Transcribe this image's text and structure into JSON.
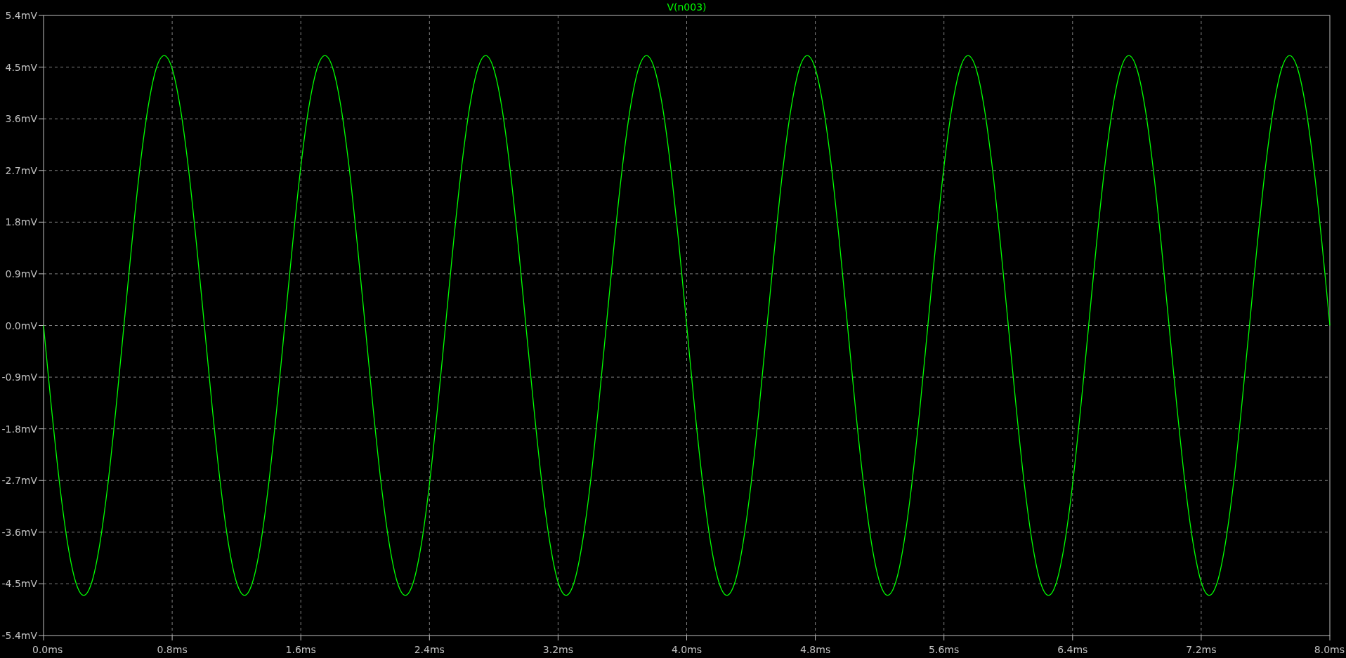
{
  "plot": {
    "chart_data": {
      "type": "line",
      "x": [
        0,
        0.05,
        0.1,
        0.15,
        0.2,
        0.25,
        0.3,
        0.35,
        0.4,
        0.45,
        0.5,
        0.55,
        0.6,
        0.65,
        0.7,
        0.75,
        0.8,
        0.85,
        0.9,
        0.95,
        1,
        1.05,
        1.1,
        1.15,
        1.2,
        1.25,
        1.3,
        1.35,
        1.4,
        1.45,
        1.5,
        1.55,
        1.6,
        1.65,
        1.7,
        1.75,
        1.8,
        1.85,
        1.9,
        1.95,
        2,
        2.05,
        2.1,
        2.15,
        2.2,
        2.25,
        2.3,
        2.35,
        2.4,
        2.45,
        2.5,
        2.55,
        2.6,
        2.65,
        2.7,
        2.75,
        2.8,
        2.85,
        2.9,
        2.95,
        3,
        3.05,
        3.1,
        3.15,
        3.2,
        3.25,
        3.3,
        3.35,
        3.4,
        3.45,
        3.5,
        3.55,
        3.6,
        3.65,
        3.7,
        3.75,
        3.8,
        3.85,
        3.9,
        3.95,
        4,
        4.05,
        4.1,
        4.15,
        4.2,
        4.25,
        4.3,
        4.35,
        4.4,
        4.45,
        4.5,
        4.55,
        4.6,
        4.65,
        4.7,
        4.75,
        4.8,
        4.85,
        4.9,
        4.95,
        5,
        5.05,
        5.1,
        5.15,
        5.2,
        5.25,
        5.3,
        5.35,
        5.4,
        5.45,
        5.5,
        5.55,
        5.6,
        5.65,
        5.7,
        5.75,
        5.8,
        5.85,
        5.9,
        5.95,
        6,
        6.05,
        6.1,
        6.15,
        6.2,
        6.25,
        6.3,
        6.35,
        6.4,
        6.45,
        6.5,
        6.55,
        6.6,
        6.65,
        6.7,
        6.75,
        6.8,
        6.85,
        6.9,
        6.95,
        7,
        7.05,
        7.1,
        7.15,
        7.2,
        7.25,
        7.3,
        7.35,
        7.4,
        7.45,
        7.5,
        7.55,
        7.6,
        7.65,
        7.7,
        7.75,
        7.8,
        7.85,
        7.9,
        7.95,
        8
      ],
      "series": [
        {
          "name": "V(n003)",
          "color": "#00ff00",
          "values": [
            0,
            -1.452,
            -2.764,
            -3.802,
            -4.47,
            -4.7,
            -4.47,
            -3.802,
            -2.764,
            -1.452,
            0,
            1.452,
            2.764,
            3.802,
            4.47,
            4.7,
            4.47,
            3.802,
            2.764,
            1.452,
            0,
            -1.452,
            -2.764,
            -3.802,
            -4.47,
            -4.7,
            -4.47,
            -3.802,
            -2.764,
            -1.452,
            0,
            1.452,
            2.764,
            3.802,
            4.47,
            4.7,
            4.47,
            3.802,
            2.764,
            1.452,
            0,
            -1.452,
            -2.764,
            -3.802,
            -4.47,
            -4.7,
            -4.47,
            -3.802,
            -2.764,
            -1.452,
            0,
            1.452,
            2.764,
            3.802,
            4.47,
            4.7,
            4.47,
            3.802,
            2.764,
            1.452,
            0,
            -1.452,
            -2.764,
            -3.802,
            -4.47,
            -4.7,
            -4.47,
            -3.802,
            -2.764,
            -1.452,
            0,
            1.452,
            2.764,
            3.802,
            4.47,
            4.7,
            4.47,
            3.802,
            2.764,
            1.452,
            0,
            -1.452,
            -2.764,
            -3.802,
            -4.47,
            -4.7,
            -4.47,
            -3.802,
            -2.764,
            -1.452,
            0,
            1.452,
            2.764,
            3.802,
            4.47,
            4.7,
            4.47,
            3.802,
            2.764,
            1.452,
            0,
            -1.452,
            -2.764,
            -3.802,
            -4.47,
            -4.7,
            -4.47,
            -3.802,
            -2.764,
            -1.452,
            0,
            1.452,
            2.764,
            3.802,
            4.47,
            4.7,
            4.47,
            3.802,
            2.764,
            1.452,
            0,
            -1.452,
            -2.764,
            -3.802,
            -4.47,
            -4.7,
            -4.47,
            -3.802,
            -2.764,
            -1.452,
            0,
            1.452,
            2.764,
            3.802,
            4.47,
            4.7,
            4.47,
            3.802,
            2.764,
            1.452,
            0,
            -1.452,
            -2.764,
            -3.802,
            -4.47,
            -4.7,
            -4.47,
            -3.802,
            -2.764,
            -1.452,
            0,
            1.452,
            2.764,
            3.802,
            4.47,
            4.7,
            4.47,
            3.802,
            2.764,
            1.452,
            0
          ]
        }
      ],
      "grid": true,
      "xlim": [
        0,
        8
      ],
      "ylim": [
        -5.4,
        5.4
      ],
      "xticks": [
        {
          "value": 0,
          "label": "0.0ms"
        },
        {
          "value": 0.8,
          "label": "0.8ms"
        },
        {
          "value": 1.6,
          "label": "1.6ms"
        },
        {
          "value": 2.4,
          "label": "2.4ms"
        },
        {
          "value": 3.2,
          "label": "3.2ms"
        },
        {
          "value": 4.0,
          "label": "4.0ms"
        },
        {
          "value": 4.8,
          "label": "4.8ms"
        },
        {
          "value": 5.6,
          "label": "5.6ms"
        },
        {
          "value": 6.4,
          "label": "6.4ms"
        },
        {
          "value": 7.2,
          "label": "7.2ms"
        },
        {
          "value": 8.0,
          "label": "8.0ms"
        }
      ],
      "yticks": [
        {
          "value": 5.4,
          "label": "5.4mV"
        },
        {
          "value": 4.5,
          "label": "4.5mV"
        },
        {
          "value": 3.6,
          "label": "3.6mV"
        },
        {
          "value": 2.7,
          "label": "2.7mV"
        },
        {
          "value": 1.8,
          "label": "1.8mV"
        },
        {
          "value": 0.9,
          "label": "0.9mV"
        },
        {
          "value": 0,
          "label": "0.0mV"
        },
        {
          "value": -0.9,
          "label": "-0.9mV"
        },
        {
          "value": -1.8,
          "label": "-1.8mV"
        },
        {
          "value": -2.7,
          "label": "-2.7mV"
        },
        {
          "value": -3.6,
          "label": "-3.6mV"
        },
        {
          "value": -4.5,
          "label": "-4.5mV"
        },
        {
          "value": -5.4,
          "label": "-5.4mV"
        }
      ]
    }
  }
}
